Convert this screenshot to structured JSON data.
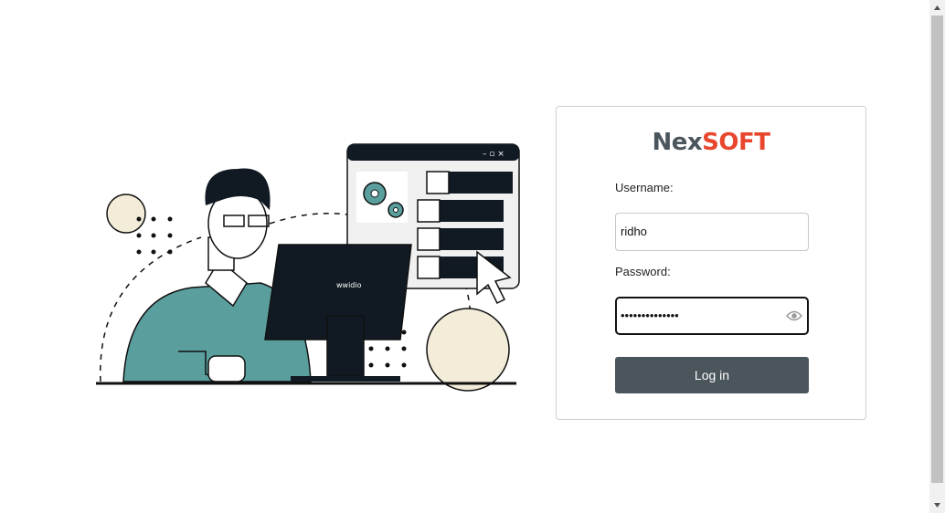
{
  "brand": {
    "part1": "Nex",
    "part2": "SOFT"
  },
  "form": {
    "username_label": "Username:",
    "username_value": "ridho",
    "password_label": "Password:",
    "password_value": "••••••••••••••",
    "login_label": "Log in"
  },
  "illustration": {
    "monitor_text": "wwidio"
  },
  "colors": {
    "brand_dark": "#4b565c",
    "brand_accent": "#e8472d",
    "teal": "#5a9e9e",
    "navy": "#111a22",
    "cream": "#f3ecd9"
  },
  "icons": [
    "gear-icon",
    "cursor-arrow-icon",
    "eye-icon"
  ]
}
